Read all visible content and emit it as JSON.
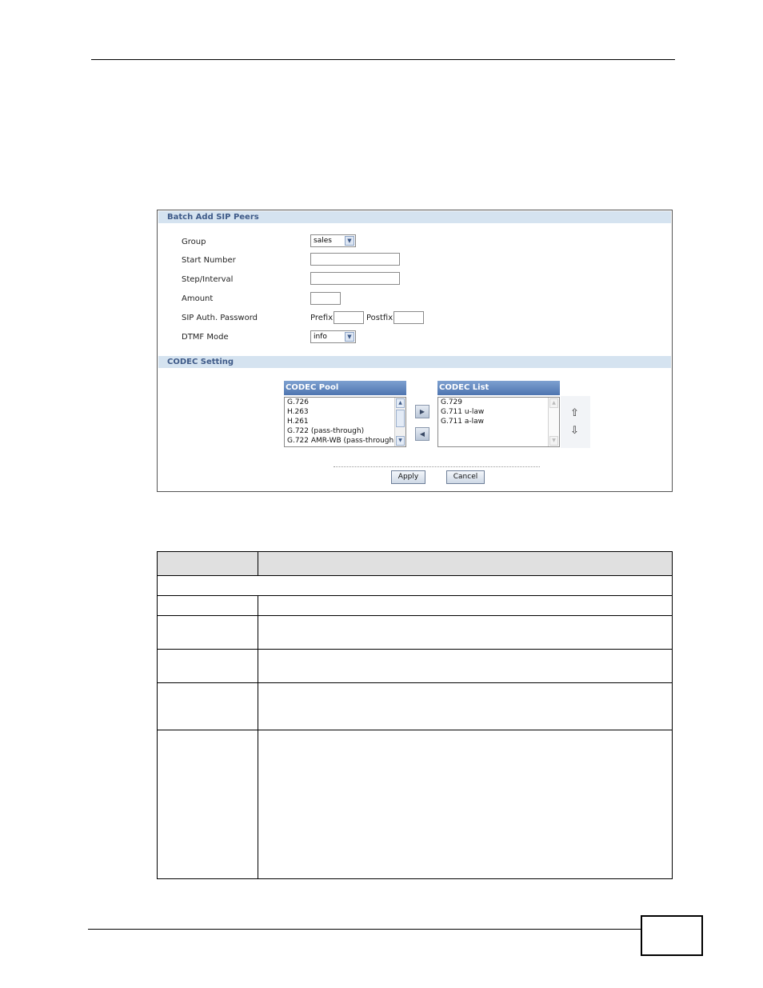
{
  "batch_panel": {
    "title": "Batch Add SIP Peers",
    "fields": {
      "group_label": "Group",
      "group_value": "sales",
      "start_number_label": "Start Number",
      "step_interval_label": "Step/Interval",
      "amount_label": "Amount",
      "sip_auth_password_label": "SIP Auth. Password",
      "prefix_label": "Prefix",
      "postfix_label": "Postfix",
      "dtmf_mode_label": "DTMF Mode",
      "dtmf_mode_value": "info"
    },
    "codec_setting": {
      "title": "CODEC Setting",
      "pool_title": "CODEC Pool",
      "pool_items": [
        "G.726",
        "H.263",
        "H.261",
        "G.722 (pass-through)",
        "G.722 AMR-WB (pass-through)"
      ],
      "list_title": "CODEC List",
      "list_items": [
        "G.729",
        "G.711 u-law",
        "G.711 a-law"
      ]
    },
    "apply_label": "Apply",
    "cancel_label": "Cancel"
  },
  "icons": [
    "chevron-down-icon",
    "arrow-right-icon",
    "arrow-left-icon",
    "arrow-up-icon",
    "arrow-down-icon",
    "scroll-up-icon",
    "scroll-down-icon"
  ]
}
